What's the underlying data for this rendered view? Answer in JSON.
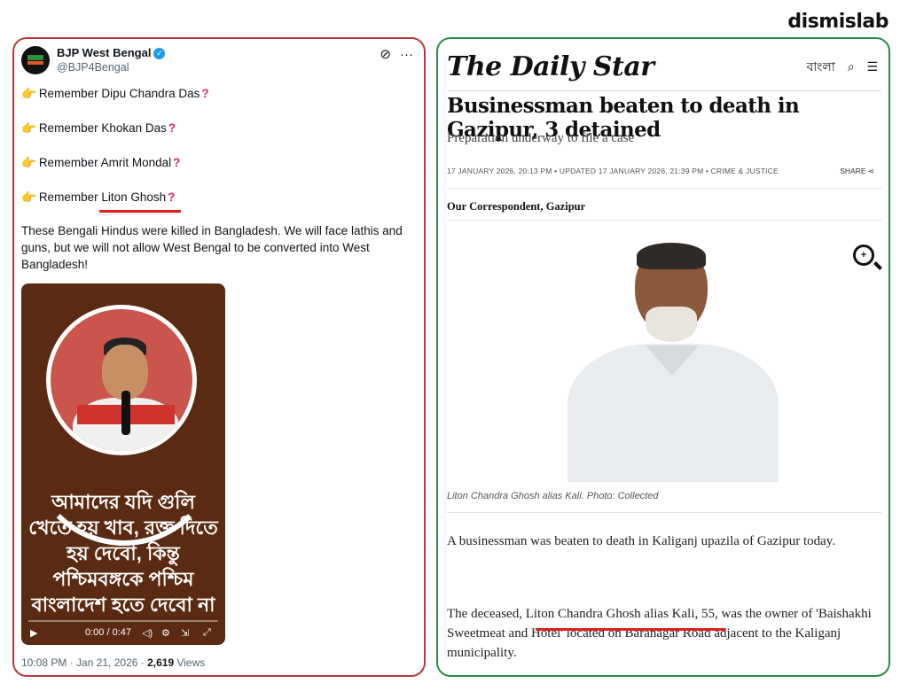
{
  "watermark": "dismislab",
  "tweet": {
    "author_name": "BJP West Bengal",
    "handle": "@BJP4Bengal",
    "lines": [
      "Remember Dipu Chandra Das",
      "Remember Khokan Das",
      "Remember Amrit Mondal",
      "Remember Liton Ghosh"
    ],
    "body": "These Bengali Hindus were killed in Bangladesh. We will face lathis and guns, but we will not allow West Bengal to be converted into West Bangladesh!",
    "video": {
      "overlay_text": "আমাদের যদি গুলি খেতে হয় খাব, রক্ত দিতে হয় দেবো, কিন্তু পশ্চিমবঙ্গকে পশ্চিম বাংলাদেশ হতে দেবো না",
      "time": "0:00 / 0:47"
    },
    "timestamp": "10:08 PM · Jan 21, 2026 · ",
    "views_count": "2,619",
    "views_label": " Views"
  },
  "article": {
    "logo": "The Daily Star",
    "lang_link": "বাংলা",
    "headline": "Businessman beaten to death in Gazipur, 3 detained",
    "subheadline": "Preparation underway to file a case",
    "dateline": "17 JANUARY 2026, 20:13 PM • UPDATED 17 JANUARY 2026, 21:39 PM • CRIME & JUSTICE",
    "share": "SHARE",
    "byline": "Our Correspondent, Gazipur",
    "caption": "Liton Chandra Ghosh alias Kali. Photo: Collected",
    "paragraph1": "A businessman was beaten to death in Kaliganj upazila of Gazipur today.",
    "paragraph2": "The deceased, Liton Chandra Ghosh alias Kali, 55, was the owner of 'Baishakhi Sweetmeat and Hotel' located on Baranagar Road adjacent to the Kaliganj municipality."
  },
  "colors": {
    "left_border": "#b43a3a",
    "right_border": "#2b8a4a",
    "highlight_underline": "#e02020"
  }
}
